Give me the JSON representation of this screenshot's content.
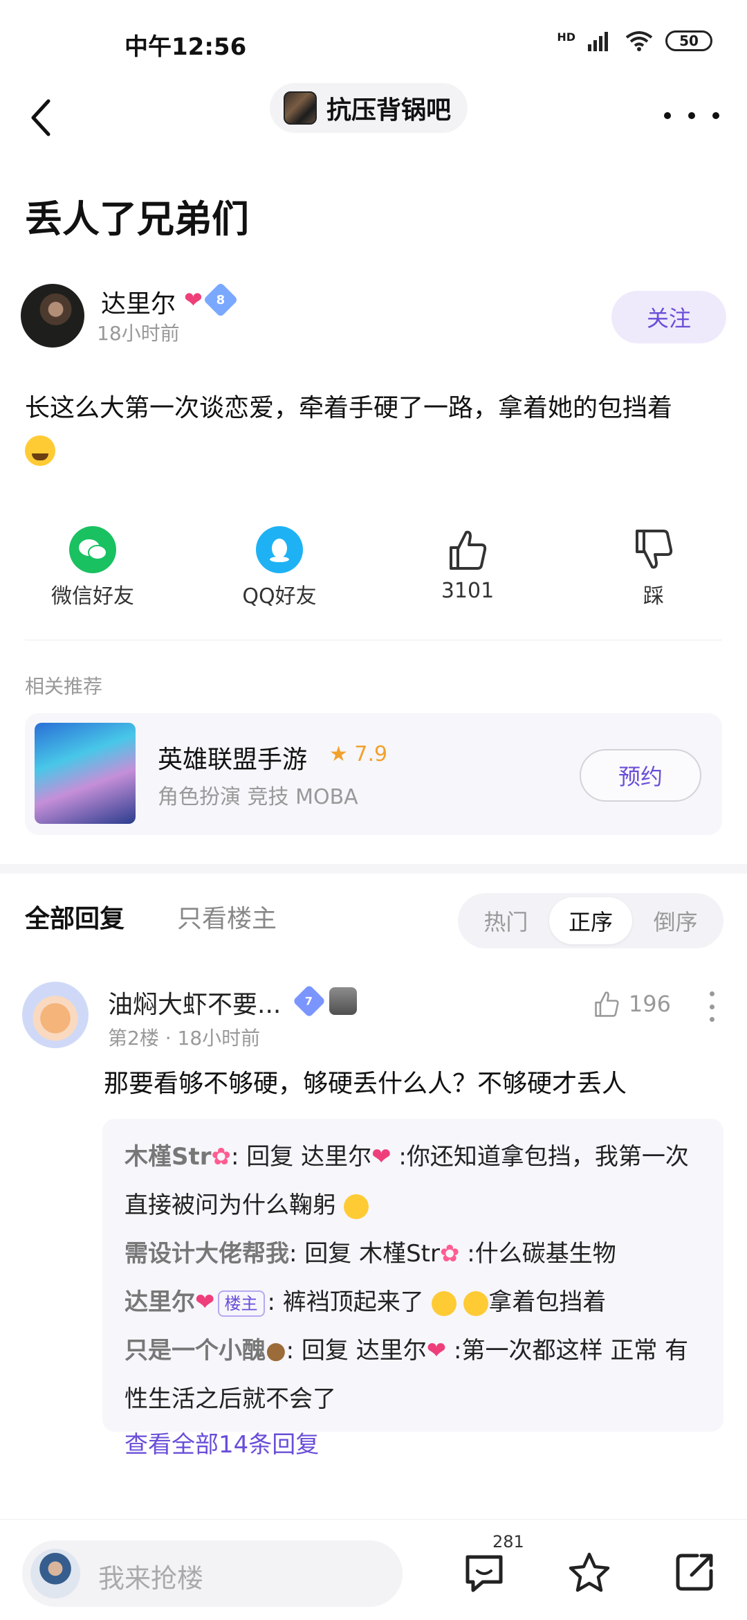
{
  "status": {
    "time": "中午12:56",
    "battery": "50",
    "network": "HD"
  },
  "nav": {
    "forum_name": "抗压背锅吧"
  },
  "post": {
    "title": "丢人了兄弟们",
    "author": {
      "name": "达里尔",
      "level": "8",
      "time": "18小时前",
      "follow_label": "关注"
    },
    "body": "长这么大第一次谈恋爱，牵着手硬了一路，拿着她的包挡着"
  },
  "share": {
    "wechat": "微信好友",
    "qq": "QQ好友",
    "likes": "3101",
    "dislike": "踩"
  },
  "related": {
    "label": "相关推荐",
    "game": {
      "title": "英雄联盟手游",
      "rating": "★ 7.9",
      "tags": "角色扮演  竞技  MOBA",
      "action": "预约"
    }
  },
  "reply_tabs": {
    "all": "全部回复",
    "op_only": "只看楼主",
    "sort": [
      "热门",
      "正序",
      "倒序"
    ],
    "active_sort": "正序"
  },
  "comments": [
    {
      "name": "油焖大虾不要...",
      "level": "7",
      "meta": "第2楼 · 18小时前",
      "likes": "196",
      "body": "那要看够不够硬，够硬丢什么人？不够硬才丢人",
      "replies": [
        {
          "nick": "木槿Str",
          "text": ": 回复 达里尔",
          "rest": " :你还知道拿包挡，我第一次直接被问为什么鞠躬"
        },
        {
          "nick": "需设计大佬帮我",
          "text": ": 回复 木槿Str",
          "rest": " :什么碳基生物"
        },
        {
          "nick": "达里尔",
          "tag": "楼主",
          "text": ": 裤裆顶起来了",
          "rest": "拿着包挡着"
        },
        {
          "nick": "只是一个小醜",
          "text": ": 回复 达里尔",
          "rest": " :第一次都这样 正常 有性生活之后就不会了"
        }
      ],
      "view_all": "查看全部14条回复"
    }
  ],
  "bottom": {
    "placeholder": "我来抢楼",
    "reply_count": "281"
  },
  "colors": {
    "accent": "#6a4ed8",
    "wechat": "#19c161",
    "qq": "#1eb2f5",
    "rating": "#f2a12b"
  }
}
